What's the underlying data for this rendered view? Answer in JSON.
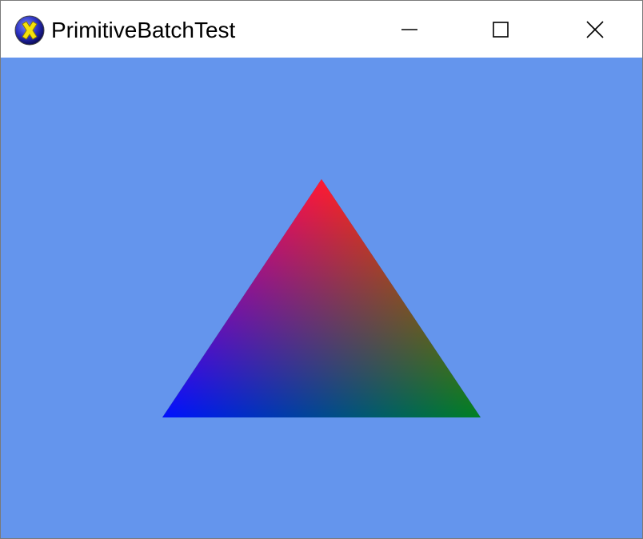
{
  "window": {
    "title": "PrimitiveBatchTest",
    "background_color": "#6495ED",
    "icons": {
      "app": "directx-icon",
      "minimize": "minimize-icon",
      "maximize": "maximize-icon",
      "close": "close-icon"
    }
  },
  "scene": {
    "primitive": "triangle",
    "vertex_colors": {
      "top": "#FF0000",
      "bottom_right": "#008000",
      "bottom_left": "#0000FF"
    }
  }
}
